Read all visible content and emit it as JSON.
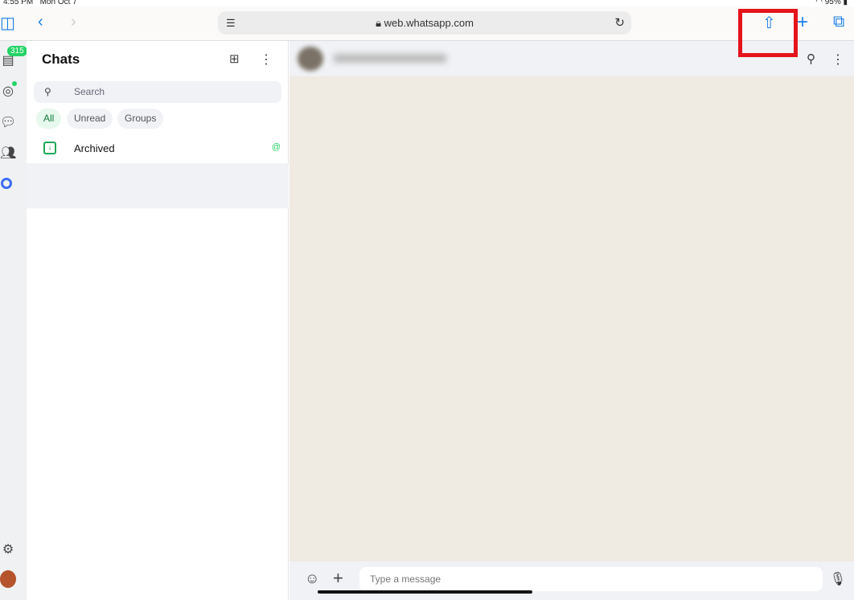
{
  "status": {
    "time": "4:55 PM",
    "date": "Mon Oct 7",
    "battery": "95%"
  },
  "browser": {
    "url": "web.whatsapp.com"
  },
  "sidebar": {
    "unread_count": "315"
  },
  "chats": {
    "title": "Chats",
    "search_placeholder": "Search",
    "filters": [
      "All",
      "Unread",
      "Groups"
    ],
    "archived_label": "Archived",
    "mention_icon": "@"
  },
  "conversation": {
    "message_placeholder": "Type a message"
  },
  "colors": {
    "accent": "#25d366",
    "highlight": "#e5141b",
    "safari_blue": "#1a7ee8"
  }
}
